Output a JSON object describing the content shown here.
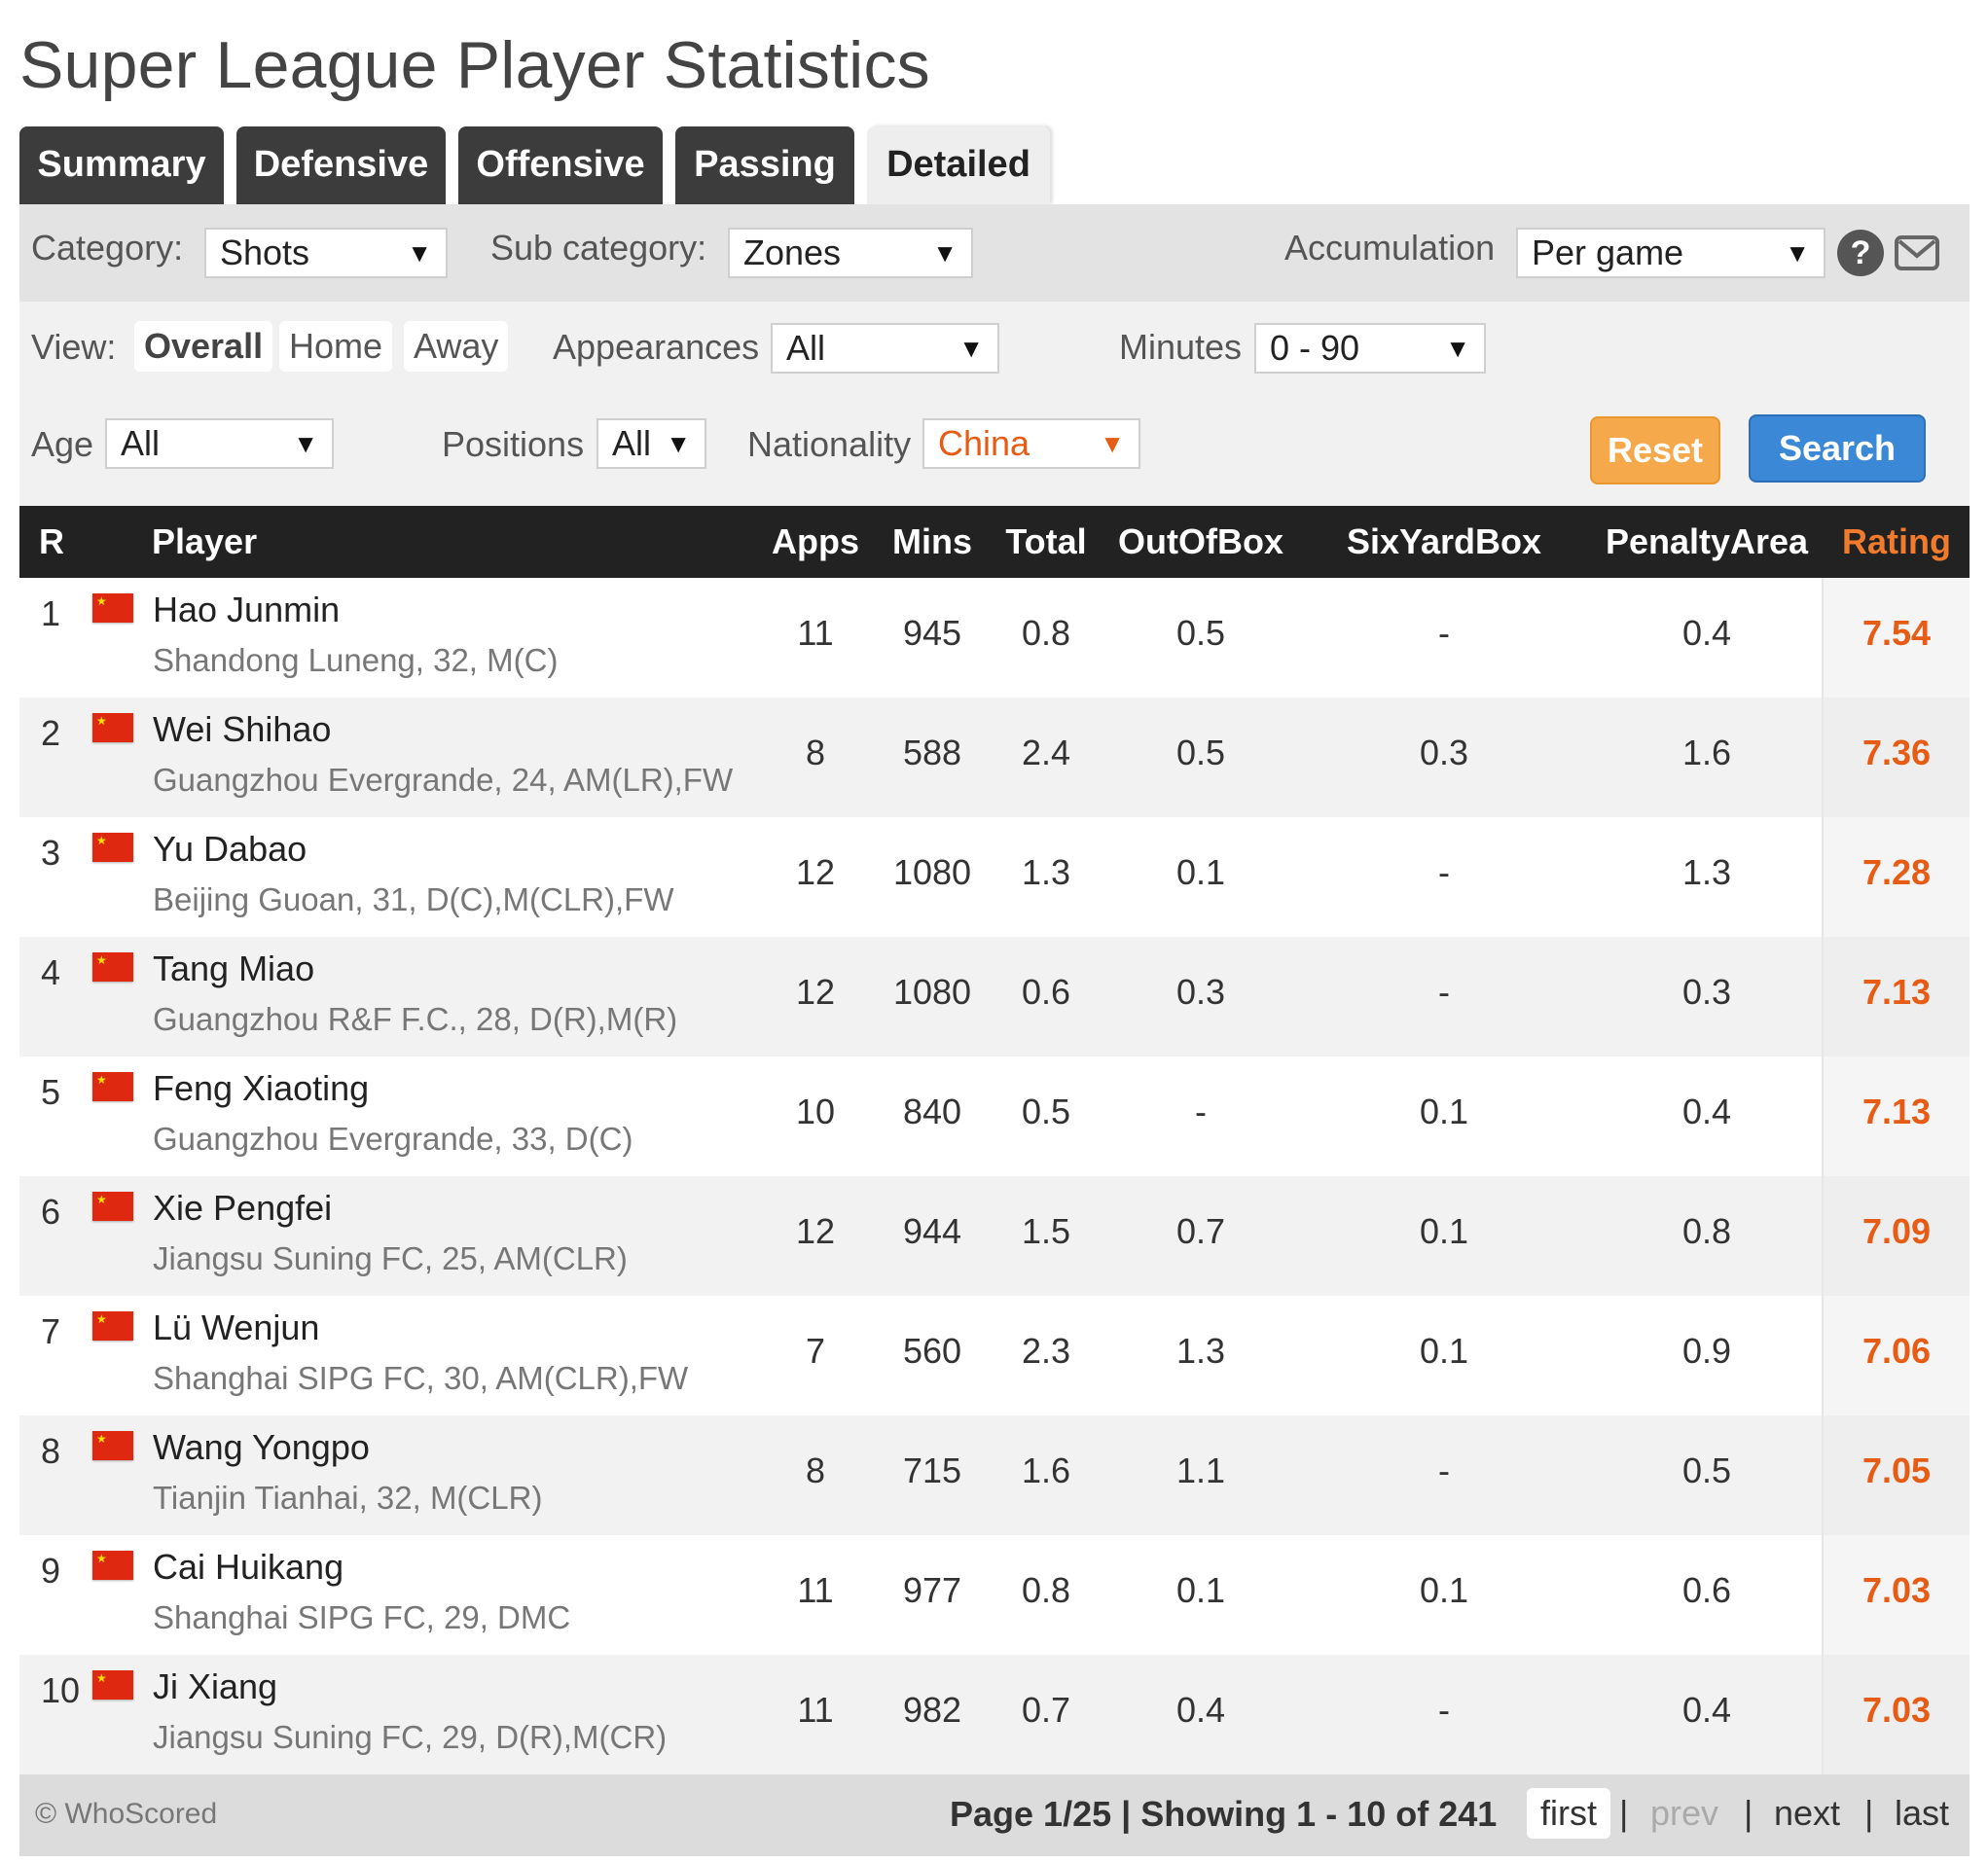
{
  "page_title": "Super League Player Statistics",
  "tabs": [
    {
      "label": "Summary"
    },
    {
      "label": "Defensive"
    },
    {
      "label": "Offensive"
    },
    {
      "label": "Passing"
    },
    {
      "label": "Detailed"
    }
  ],
  "active_tab": "Detailed",
  "filters": {
    "category_label": "Category:",
    "category_value": "Shots",
    "subcategory_label": "Sub category:",
    "subcategory_value": "Zones",
    "accumulation_label": "Accumulation",
    "accumulation_value": "Per game",
    "help_icon": "question-circle-icon",
    "help_glyph": "?",
    "mail_icon": "envelope-icon",
    "view_label": "View:",
    "view_options": [
      "Overall",
      "Home",
      "Away"
    ],
    "view_selected": "Overall",
    "appearances_label": "Appearances",
    "appearances_value": "All",
    "minutes_label": "Minutes",
    "minutes_value": "0 - 90",
    "age_label": "Age",
    "age_value": "All",
    "positions_label": "Positions",
    "positions_value": "All",
    "nationality_label": "Nationality",
    "nationality_value": "China",
    "reset_label": "Reset",
    "search_label": "Search",
    "dropdown_arrow": "▼",
    "accent_color": "#e65c14"
  },
  "table": {
    "headers": {
      "rank": "R",
      "player": "Player",
      "apps": "Apps",
      "mins": "Mins",
      "total": "Total",
      "outofbox": "OutOfBox",
      "sixyardbox": "SixYardBox",
      "penaltyarea": "PenaltyArea",
      "rating": "Rating"
    },
    "rows": [
      {
        "rank": "1",
        "name": "Hao Junmin",
        "meta": "Shandong Luneng, 32, M(C)",
        "apps": "11",
        "mins": "945",
        "total": "0.8",
        "outofbox": "0.5",
        "sixyardbox": "-",
        "penaltyarea": "0.4",
        "rating": "7.54"
      },
      {
        "rank": "2",
        "name": "Wei Shihao",
        "meta": "Guangzhou Evergrande, 24, AM(LR),FW",
        "apps": "8",
        "mins": "588",
        "total": "2.4",
        "outofbox": "0.5",
        "sixyardbox": "0.3",
        "penaltyarea": "1.6",
        "rating": "7.36"
      },
      {
        "rank": "3",
        "name": "Yu Dabao",
        "meta": "Beijing Guoan, 31, D(C),M(CLR),FW",
        "apps": "12",
        "mins": "1080",
        "total": "1.3",
        "outofbox": "0.1",
        "sixyardbox": "-",
        "penaltyarea": "1.3",
        "rating": "7.28"
      },
      {
        "rank": "4",
        "name": "Tang Miao",
        "meta": "Guangzhou R&F F.C., 28, D(R),M(R)",
        "apps": "12",
        "mins": "1080",
        "total": "0.6",
        "outofbox": "0.3",
        "sixyardbox": "-",
        "penaltyarea": "0.3",
        "rating": "7.13"
      },
      {
        "rank": "5",
        "name": "Feng Xiaoting",
        "meta": "Guangzhou Evergrande, 33, D(C)",
        "apps": "10",
        "mins": "840",
        "total": "0.5",
        "outofbox": "-",
        "sixyardbox": "0.1",
        "penaltyarea": "0.4",
        "rating": "7.13"
      },
      {
        "rank": "6",
        "name": "Xie Pengfei",
        "meta": "Jiangsu Suning FC, 25, AM(CLR)",
        "apps": "12",
        "mins": "944",
        "total": "1.5",
        "outofbox": "0.7",
        "sixyardbox": "0.1",
        "penaltyarea": "0.8",
        "rating": "7.09"
      },
      {
        "rank": "7",
        "name": "Lü Wenjun",
        "meta": "Shanghai SIPG FC, 30, AM(CLR),FW",
        "apps": "7",
        "mins": "560",
        "total": "2.3",
        "outofbox": "1.3",
        "sixyardbox": "0.1",
        "penaltyarea": "0.9",
        "rating": "7.06"
      },
      {
        "rank": "8",
        "name": "Wang Yongpo",
        "meta": "Tianjin Tianhai, 32, M(CLR)",
        "apps": "8",
        "mins": "715",
        "total": "1.6",
        "outofbox": "1.1",
        "sixyardbox": "-",
        "penaltyarea": "0.5",
        "rating": "7.05"
      },
      {
        "rank": "9",
        "name": "Cai Huikang",
        "meta": "Shanghai SIPG FC, 29, DMC",
        "apps": "11",
        "mins": "977",
        "total": "0.8",
        "outofbox": "0.1",
        "sixyardbox": "0.1",
        "penaltyarea": "0.6",
        "rating": "7.03"
      },
      {
        "rank": "10",
        "name": "Ji Xiang",
        "meta": "Jiangsu Suning FC, 29, D(R),M(CR)",
        "apps": "11",
        "mins": "982",
        "total": "0.7",
        "outofbox": "0.4",
        "sixyardbox": "-",
        "penaltyarea": "0.4",
        "rating": "7.03"
      }
    ],
    "flag_icon": "china-flag-icon"
  },
  "footer": {
    "copyright": "© WhoScored",
    "page_info": "Page 1/25 | Showing 1 - 10 of 241",
    "first": "first",
    "prev": "prev",
    "next": "next",
    "last": "last",
    "separator": "|"
  }
}
